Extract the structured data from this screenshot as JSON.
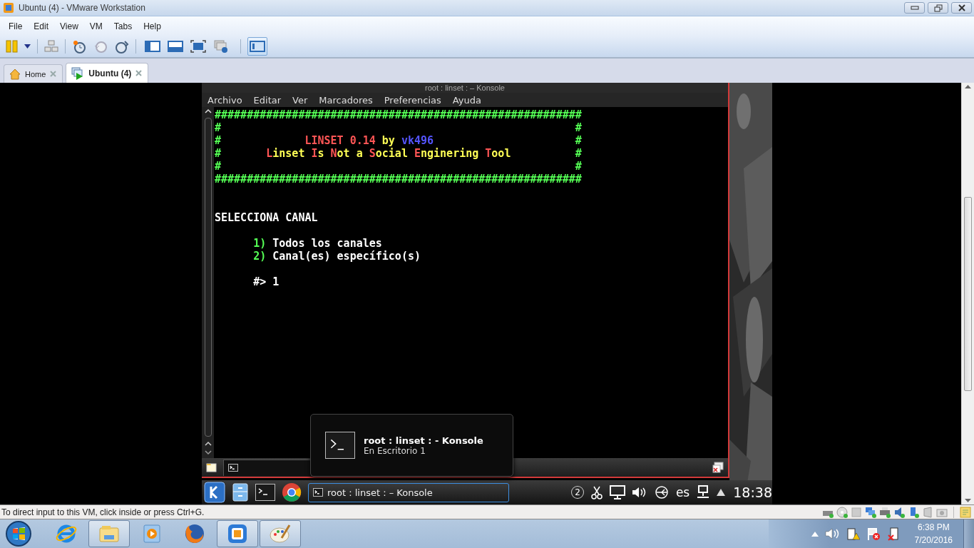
{
  "window": {
    "title": "Ubuntu (4) - VMware Workstation"
  },
  "menu": [
    "File",
    "Edit",
    "View",
    "VM",
    "Tabs",
    "Help"
  ],
  "toolbar": {
    "view_buttons": [
      {
        "selected": false
      },
      {
        "selected": false
      },
      {
        "selected": false
      },
      {
        "selected": false
      },
      {
        "selected": true
      }
    ]
  },
  "tabs": [
    {
      "label": "Home",
      "selected": false
    },
    {
      "label": "Ubuntu (4)",
      "selected": true
    }
  ],
  "konsole": {
    "title": "root : linset :  – Konsole",
    "menu": [
      "Archivo",
      "Editar",
      "Ver",
      "Marcadores",
      "Preferencias",
      "Ayuda"
    ],
    "terminal": [
      {
        "kind": "banner",
        "lines": [
          [
            {
              "text": "#########################################################",
              "color": "#55ff55"
            }
          ],
          [
            {
              "text": "#                                                       #",
              "color": "#55ff55"
            }
          ],
          [
            {
              "text": "#",
              "color": "#55ff55"
            },
            {
              "text": "             LINSET 0.14",
              "color": "#ff5555"
            },
            {
              "text": " by",
              "color": "#ffff55"
            },
            {
              "text": " vk496",
              "color": "#5555ff"
            },
            {
              "text": "                      #",
              "color": "#55ff55"
            }
          ],
          [
            {
              "text": "#",
              "color": "#55ff55"
            },
            {
              "text": "       L",
              "color": "#ff5555"
            },
            {
              "text": "inset ",
              "color": "#ffff55"
            },
            {
              "text": "I",
              "color": "#ff5555"
            },
            {
              "text": "s ",
              "color": "#ffff55"
            },
            {
              "text": "N",
              "color": "#ff5555"
            },
            {
              "text": "ot a ",
              "color": "#ffff55"
            },
            {
              "text": "S",
              "color": "#ff5555"
            },
            {
              "text": "ocial ",
              "color": "#ffff55"
            },
            {
              "text": "E",
              "color": "#ff5555"
            },
            {
              "text": "nginering ",
              "color": "#ffff55"
            },
            {
              "text": "T",
              "color": "#ff5555"
            },
            {
              "text": "ool",
              "color": "#ffff55"
            },
            {
              "text": "          #",
              "color": "#55ff55"
            }
          ],
          [
            {
              "text": "#                                                       #",
              "color": "#55ff55"
            }
          ],
          [
            {
              "text": "#########################################################",
              "color": "#55ff55"
            }
          ]
        ]
      },
      {
        "kind": "heading",
        "lines": [
          [
            {
              "text": "SELECCIONA CANAL",
              "color": "#ffffff"
            }
          ]
        ]
      },
      {
        "kind": "menu",
        "lines": [
          [
            {
              "text": "      1)",
              "color": "#55ff55"
            },
            {
              "text": " Todos los canales",
              "color": "#ffffff"
            }
          ],
          [
            {
              "text": "      2)",
              "color": "#55ff55"
            },
            {
              "text": " Canal(es) específico(s)",
              "color": "#ffffff"
            }
          ]
        ]
      },
      {
        "kind": "prompt",
        "lines": [
          [
            {
              "text": "      #> 1",
              "color": "#ffffff"
            }
          ]
        ]
      }
    ]
  },
  "notification": {
    "title": "root : linset :  - Konsole",
    "subtitle": "En Escritorio 1"
  },
  "kde_panel": {
    "pager": "2",
    "task": "root : linset :  – Konsole",
    "language": "es",
    "clock": "18:38"
  },
  "status_bar": {
    "message": "To direct input to this VM, click inside or press Ctrl+G."
  },
  "taskbar": {
    "apps": [
      {
        "kind": "ie",
        "running": false
      },
      {
        "kind": "explorer",
        "running": true
      },
      {
        "kind": "media",
        "running": false
      },
      {
        "kind": "firefox",
        "running": false
      },
      {
        "kind": "vmware",
        "running": true
      },
      {
        "kind": "paint",
        "running": true
      }
    ],
    "clock": "6:38 PM",
    "date": "7/20/2016"
  }
}
